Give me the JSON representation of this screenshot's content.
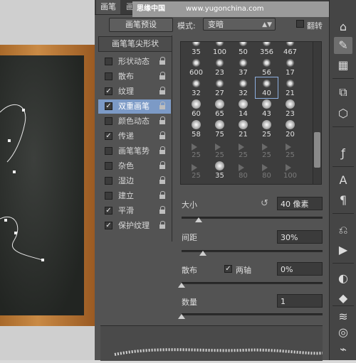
{
  "tabs": [
    "画笔",
    "画笔预设"
  ],
  "watermark": {
    "logo": "思缘中国",
    "url": "www.yugonchina.com"
  },
  "toolbar": {
    "preset_button": "画笔预设",
    "mode_label": "模式:",
    "mode_value": "变暗",
    "flip_label": "翻转"
  },
  "sidebar": {
    "header": "画笔笔尖形状",
    "items": [
      {
        "label": "形状动态",
        "checked": false
      },
      {
        "label": "散布",
        "checked": false
      },
      {
        "label": "纹理",
        "checked": true
      },
      {
        "label": "双重画笔",
        "checked": true
      },
      {
        "label": "颜色动态",
        "checked": false
      },
      {
        "label": "传递",
        "checked": true
      },
      {
        "label": "画笔笔势",
        "checked": false
      },
      {
        "label": "杂色",
        "checked": false
      },
      {
        "label": "湿边",
        "checked": false
      },
      {
        "label": "建立",
        "checked": false
      },
      {
        "label": "平滑",
        "checked": true
      },
      {
        "label": "保护纹理",
        "checked": true
      }
    ],
    "selected_index": 3
  },
  "brushes": [
    [
      "35",
      "100",
      "50",
      "356",
      "467"
    ],
    [
      "600",
      "23",
      "37",
      "56",
      "17"
    ],
    [
      "32",
      "27",
      "32",
      "40",
      "21"
    ],
    [
      "60",
      "65",
      "14",
      "43",
      "23"
    ],
    [
      "58",
      "75",
      "21",
      "25",
      "20"
    ],
    [
      "25",
      "25",
      "25",
      "25",
      "25"
    ],
    [
      "25",
      "35",
      "80",
      "80",
      "100"
    ]
  ],
  "size": {
    "label": "大小",
    "value": "40 像素",
    "level": 0.12
  },
  "spacing": {
    "label": "间距",
    "value": "30%",
    "level": 0.15
  },
  "scatter": {
    "label": "散布",
    "both_axes_label": "两轴",
    "value": "0%",
    "level": 0
  },
  "count": {
    "label": "数量",
    "value": "1",
    "level": 0
  },
  "colors": {
    "panel": "#535353",
    "selected": "#7c9ac6",
    "board": "#2c2f2c",
    "frame": "#b87a3a"
  }
}
